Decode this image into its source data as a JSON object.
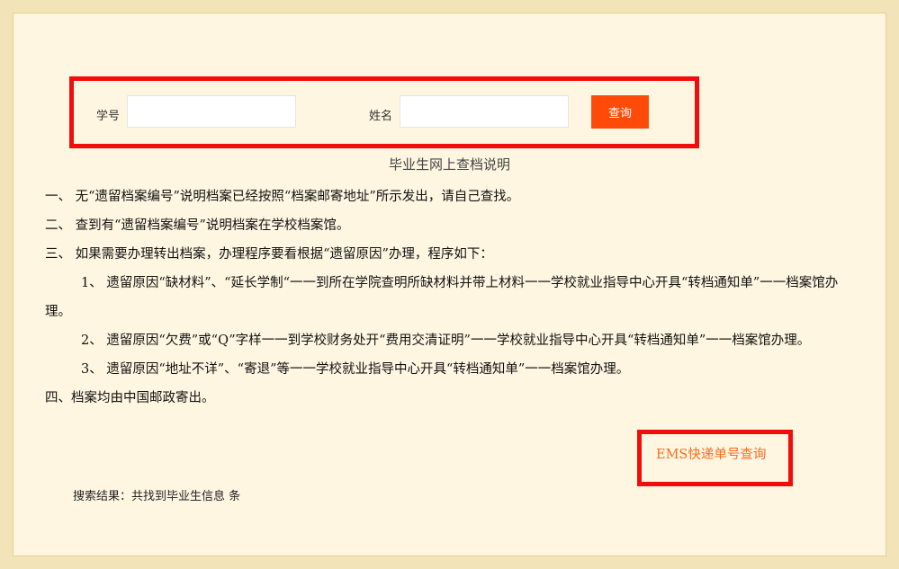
{
  "search": {
    "student_id_label": "学号",
    "student_id_value": "",
    "name_label": "姓名",
    "name_value": "",
    "button_label": "查询"
  },
  "doc": {
    "title": "毕业生网上查档说明",
    "paragraphs": [
      "一、  无“遗留档案编号”说明档案已经按照“档案邮寄地址”所示发出，请自己查找。",
      "二、  查到有“遗留档案编号”说明档案在学校档案馆。",
      "三、  如果需要办理转出档案，办理程序要看根据“遗留原因”办理，程序如下：",
      "1、  遗留原因“缺材料”、“延长学制“一一到所在学院查明所缺材料并带上材料一一学校就业指导中心开具“转档通知单”一一档案馆办理。",
      "2、  遗留原因“欠费”或“Q”字样一一到学校财务处开“费用交清证明”一一学校就业指导中心开具“转档通知单”一一档案馆办理。",
      "3、  遗留原因“地址不详”、“寄退”等一一学校就业指导中心开具“转档通知单”一一档案馆办理。",
      "四、档案均由中国邮政寄出。"
    ]
  },
  "ems_link": "EMS快递单号查询",
  "result_text": "搜索结果：共找到毕业生信息 条",
  "colors": {
    "background": "#fef6e1",
    "button": "#ff4b0a",
    "highlight_box": "#f20c0c",
    "link": "#ff6a1a"
  }
}
